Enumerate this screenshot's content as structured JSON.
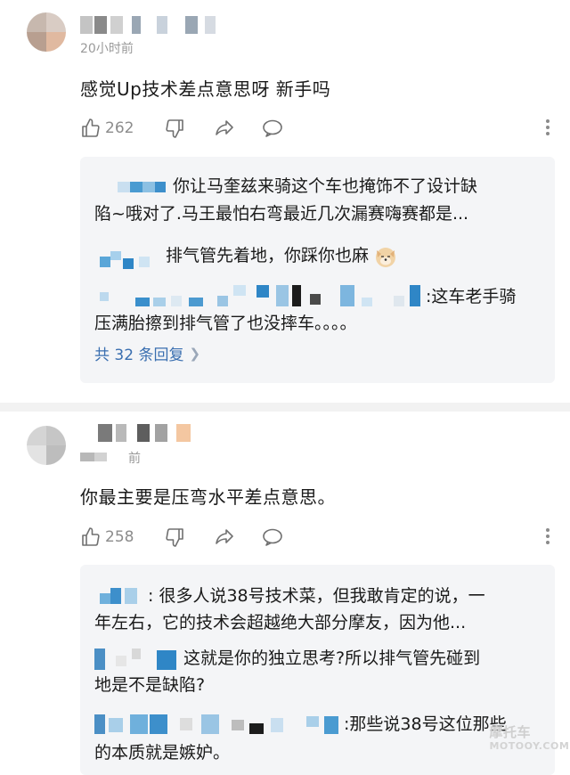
{
  "comments": [
    {
      "time": "20小时前",
      "text": "感觉Up技术差点意思呀 新手吗",
      "likes": "262",
      "replies": [
        {
          "text_line1": "你让马奎兹来骑这个车也掩饰不了设计缺",
          "text_line2": "陷~哦对了.马王最怕右弯最近几次漏赛嗨赛都是..."
        },
        {
          "text_line1": "排气管先着地，你踩你也麻"
        },
        {
          "text_line1": ":这车老手骑",
          "text_line2": "压满胎擦到排气管了也没摔车。。。。"
        }
      ],
      "view_all": "共 32 条回复"
    },
    {
      "time": "前",
      "text": "你最主要是压弯水平差点意思。",
      "likes": "258",
      "replies": [
        {
          "text_line1": ": 很多人说38号技术菜，但我敢肯定的说，一",
          "text_line2": "年左右，它的技术会超越绝大部分摩友，因为他..."
        },
        {
          "text_line1": "这就是你的独立思考?所以排气管先碰到",
          "text_line2": "地是不是缺陷?"
        },
        {
          "text_line1": ":那些说38号这位那些",
          "text_line2": "的本质就是嫉妒。"
        }
      ]
    }
  ],
  "watermark": "摩托车",
  "watermark_sub": "MOTOOY.COM",
  "icons": {
    "like": "thumbs-up-icon",
    "dislike": "thumbs-down-icon",
    "share": "share-icon",
    "comment": "comment-bubble-icon",
    "more": "more-vertical-icon",
    "chevron": "chevron-right-icon",
    "emoji": "dog-emoji-icon"
  },
  "colors": {
    "link": "#3a6fb0",
    "muted": "#8c8c8c",
    "reply_bg": "#f4f5f7"
  }
}
